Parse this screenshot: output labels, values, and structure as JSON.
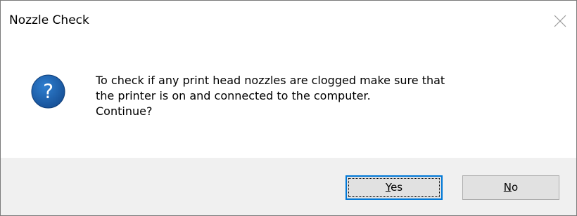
{
  "dialog": {
    "title": "Nozzle Check",
    "close_icon": "close-icon",
    "icon": "question-icon",
    "icon_color": "#1a5eaa",
    "message_lines": [
      "To check if any print head nozzles are clogged make sure that",
      "the printer is on and connected to the computer.",
      "Continue?"
    ],
    "buttons": {
      "yes": {
        "mnemonic": "Y",
        "rest": "es"
      },
      "no": {
        "mnemonic": "N",
        "rest": "o"
      }
    },
    "accent_color": "#0078d7"
  }
}
